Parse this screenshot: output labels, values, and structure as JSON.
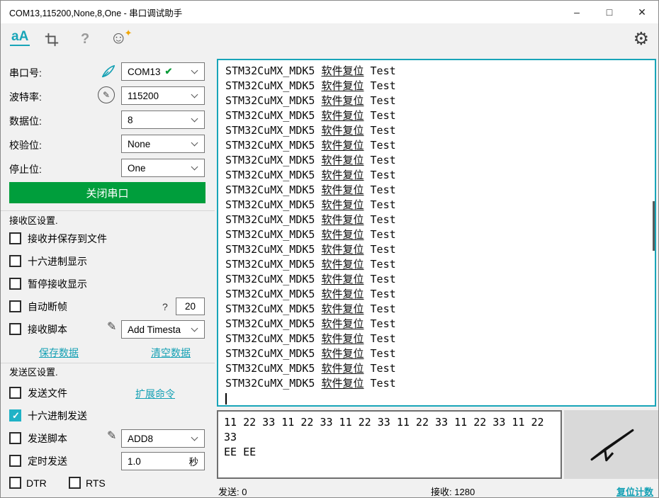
{
  "window": {
    "title": "COM13,115200,None,8,One - 串口调试助手",
    "controls": {
      "minimize": "–",
      "maximize": "□",
      "close": "✕"
    }
  },
  "toolbar": {
    "font_icon": "aA",
    "help_icon": "?",
    "smiley_icon": "☺",
    "star_icon": "✦",
    "gear_icon": "⚙"
  },
  "port_settings": {
    "fields": [
      {
        "label": "串口号:",
        "value": "COM13"
      },
      {
        "label": "波特率:",
        "value": "115200"
      },
      {
        "label": "数据位:",
        "value": "8"
      },
      {
        "label": "校验位:",
        "value": "None"
      },
      {
        "label": "停止位:",
        "value": "One"
      }
    ],
    "com_check_icon": "✔",
    "pen_icon": "✎",
    "close_button": "关闭串口"
  },
  "receive_settings": {
    "title": "接收区设置.",
    "save_to_file": "接收并保存到文件",
    "hex_display": "十六进制显示",
    "pause_display": "暂停接收显示",
    "auto_frame": "自动断帧",
    "auto_frame_help": "?",
    "frame_timeout": "20",
    "receive_script": "接收脚本",
    "receive_script_value": "Add Timesta",
    "save_link": "保存数据",
    "clear_link": "清空数据"
  },
  "send_settings": {
    "title": "发送区设置.",
    "send_file": "发送文件",
    "extend_link": "扩展命令",
    "hex_send": "十六进制发送",
    "send_script": "发送脚本",
    "send_script_value": "ADD8",
    "timed_send": "定时发送",
    "timed_value": "1.0",
    "timed_unit": "秒",
    "dtr": "DTR",
    "rts": "RTS"
  },
  "receive_area": {
    "line_prefix": "STM32CuMX_MDK5 ",
    "line_underlined": "软件复位",
    "line_suffix": " Test",
    "line_count": 22
  },
  "send_area": {
    "lines": [
      "11 22 33 11 22 33 11 22 33 11 22 33 11 22 33 11 22 33",
      "EE EE"
    ]
  },
  "status_bar": {
    "sent_label": "发送:",
    "sent_value": "0",
    "received_label": "接收:",
    "received_value": "1280",
    "reset_link": "复位计数"
  },
  "colors": {
    "accent_teal": "#18a5b8",
    "button_green": "#009e3c",
    "star_orange": "#f0a500",
    "check_green": "#0a9b39"
  }
}
